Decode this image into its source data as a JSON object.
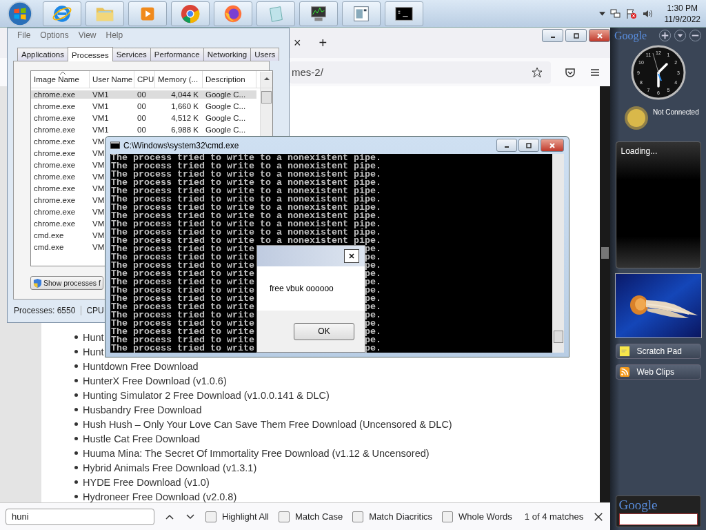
{
  "taskbar": {
    "apps": [
      {
        "kind": "ie"
      },
      {
        "kind": "folder"
      },
      {
        "kind": "media"
      },
      {
        "kind": "chrome"
      },
      {
        "kind": "firefox"
      },
      {
        "kind": "notepad"
      },
      {
        "kind": "monitor"
      },
      {
        "kind": "window"
      },
      {
        "kind": "console"
      }
    ],
    "time": "1:30 PM",
    "date": "11/9/2022"
  },
  "browser": {
    "tab_close": "×",
    "new_tab": "+",
    "url": "mes-2/",
    "list": [
      "Hunt",
      "Hunt",
      "Huntdown Free Download",
      "HunterX Free Download (v1.0.6)",
      "Hunting Simulator 2 Free Download (v1.0.0.141 & DLC)",
      "Husbandry Free Download",
      "Hush Hush – Only Your Love Can Save Them Free Download (Uncensored & DLC)",
      "Hustle Cat Free Download",
      "Huuma Mina: The Secret Of Immortality Free Download (v1.12 & Uncensored)",
      "Hybrid Animals Free Download (v1.3.1)",
      "HYDE Free Download (v1.0)",
      "Hydroneer Free Download (v2.0.8)"
    ],
    "find_bar": {
      "value": "huni",
      "options": [
        {
          "label": "Highlight All",
          "checked": false
        },
        {
          "label": "Match Case",
          "checked": false
        },
        {
          "label": "Match Diacritics",
          "checked": false
        },
        {
          "label": "Whole Words",
          "checked": false
        }
      ],
      "result": "1 of 4 matches"
    }
  },
  "task_manager": {
    "menu": [
      "File",
      "Options",
      "View",
      "Help"
    ],
    "tabs": [
      {
        "label": "Applications",
        "selected": false
      },
      {
        "label": "Processes",
        "selected": true
      },
      {
        "label": "Services",
        "selected": false
      },
      {
        "label": "Performance",
        "selected": false
      },
      {
        "label": "Networking",
        "selected": false
      },
      {
        "label": "Users",
        "selected": false
      }
    ],
    "columns": [
      "Image Name",
      "User Name",
      "CPU",
      "Memory (...",
      "Description"
    ],
    "rows": [
      {
        "image": "chrome.exe",
        "user": "VM1",
        "cpu": "00",
        "memory": "4,044 K",
        "description": "Google C...",
        "selected": true
      },
      {
        "image": "chrome.exe",
        "user": "VM1",
        "cpu": "00",
        "memory": "1,660 K",
        "description": "Google C...",
        "selected": false
      },
      {
        "image": "chrome.exe",
        "user": "VM1",
        "cpu": "00",
        "memory": "4,512 K",
        "description": "Google C...",
        "selected": false
      },
      {
        "image": "chrome.exe",
        "user": "VM1",
        "cpu": "00",
        "memory": "6,988 K",
        "description": "Google C...",
        "selected": false
      },
      {
        "image": "chrome.exe",
        "user": "VM",
        "selected": false
      },
      {
        "image": "chrome.exe",
        "user": "VM",
        "selected": false
      },
      {
        "image": "chrome.exe",
        "user": "VM",
        "selected": false
      },
      {
        "image": "chrome.exe",
        "user": "VM",
        "selected": false
      },
      {
        "image": "chrome.exe",
        "user": "VM",
        "selected": false
      },
      {
        "image": "chrome.exe",
        "user": "VM",
        "selected": false
      },
      {
        "image": "chrome.exe",
        "user": "VM",
        "selected": false
      },
      {
        "image": "chrome.exe",
        "user": "VM",
        "selected": false
      },
      {
        "image": "cmd.exe",
        "user": "VM",
        "selected": false
      },
      {
        "image": "cmd.exe",
        "user": "VM",
        "selected": false
      }
    ],
    "button": "Show processes f",
    "status": [
      "Processes: 6550",
      "CPU"
    ]
  },
  "cmd": {
    "title": "C:\\Windows\\system32\\cmd.exe",
    "lines": [
      {
        "text": "The process tried to write to a nonexistent pipe."
      },
      {
        "text": "The process tried to write to a nonexistent pipe."
      },
      {
        "text": "The process tried to write to a nonexistent pipe."
      },
      {
        "text": "The process tried to write to a nonexistent pipe."
      },
      {
        "text": "The process tried to write to a nonexistent pipe."
      },
      {
        "text": "The process tried to write to a nonexistent pipe."
      },
      {
        "text": "The process tried to write to a nonexistent pipe."
      },
      {
        "text": "The process tried to write to a nonexistent pipe."
      },
      {
        "text": "The process tried to write to a nonexistent pipe."
      },
      {
        "text": "The process tried to write to a nonexistent pipe."
      },
      {
        "text": "The process tried to write to a nonexistent pipe."
      },
      {
        "text": "The process tried to write",
        "tail": "pe."
      },
      {
        "text": "The process tried to write",
        "tail": "pe."
      },
      {
        "text": "The process tried to write",
        "tail": "pe."
      },
      {
        "text": "The process tried to write",
        "tail": "pe."
      },
      {
        "text": "The process tried to write",
        "tail": "pe."
      },
      {
        "text": "The process tried to write",
        "tail": "pe."
      },
      {
        "text": "The process tried to write",
        "tail": "pe."
      },
      {
        "text": "The process tried to write",
        "tail": "pe."
      },
      {
        "text": "The process tried to write",
        "tail": "pe."
      },
      {
        "text": "The process tried to write",
        "tail": "pe."
      },
      {
        "text": "The process tried to write",
        "tail": "pe."
      },
      {
        "text": "The process tried to write",
        "tail": "pe."
      },
      {
        "text": "The process tried to write",
        "tail": "pe."
      }
    ]
  },
  "dialog": {
    "message": "free vbuk oooooo",
    "button": "OK"
  },
  "sidebar": {
    "logo": "Google",
    "clock_numerals": [
      "12",
      "1",
      "2",
      "3",
      "4",
      "5",
      "6",
      "7",
      "8",
      "9",
      "10",
      "11"
    ],
    "weather": "Not Connected",
    "loading": "Loading...",
    "buttons": [
      {
        "kind": "note",
        "label": "Scratch Pad"
      },
      {
        "kind": "feed",
        "label": "Web Clips"
      }
    ],
    "search_logo": "Google"
  }
}
